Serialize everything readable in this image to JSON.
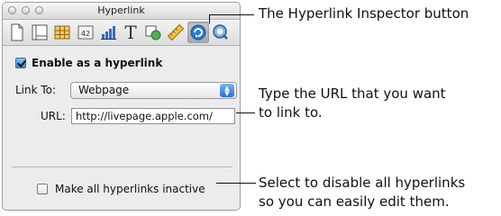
{
  "window": {
    "title": "Hyperlink"
  },
  "toolbar": {
    "tools": [
      {
        "name": "document-inspector-icon"
      },
      {
        "name": "layout-inspector-icon"
      },
      {
        "name": "table-inspector-icon"
      },
      {
        "name": "metrics-inspector-icon",
        "label": "42"
      },
      {
        "name": "graph-inspector-icon"
      },
      {
        "name": "text-inspector-icon",
        "label": "T"
      },
      {
        "name": "graphic-inspector-icon"
      },
      {
        "name": "ruler-inspector-icon"
      },
      {
        "name": "hyperlink-inspector-icon",
        "active": true
      },
      {
        "name": "quicktime-inspector-icon"
      }
    ]
  },
  "inspector": {
    "enable_label": "Enable as a hyperlink",
    "enable_checked": true,
    "link_to_label": "Link To:",
    "link_to_value": "Webpage",
    "url_label": "URL:",
    "url_value": "http://livepage.apple.com/",
    "inactive_label": "Make all hyperlinks inactive",
    "inactive_checked": false
  },
  "annotations": {
    "button": "The Hyperlink Inspector button",
    "url_line1": "Type the URL that you want",
    "url_line2": "to link to.",
    "disable_line1": "Select to disable all hyperlinks",
    "disable_line2": "so you can easily edit them."
  },
  "colors": {
    "panel_bg": "#ececec",
    "accent_blue": "#2a72d1"
  }
}
